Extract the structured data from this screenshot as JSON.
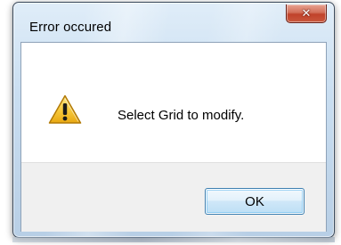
{
  "dialog": {
    "title": "Error occured",
    "close_icon_glyph": "✕",
    "message": "Select Grid to modify.",
    "icon": "warning-icon",
    "ok_label": "OK"
  },
  "colors": {
    "close_button": "#c9573c",
    "warning_yellow": "#f6c83a",
    "ok_border": "#3c7fb1",
    "button_bar": "#f0f0f0"
  }
}
